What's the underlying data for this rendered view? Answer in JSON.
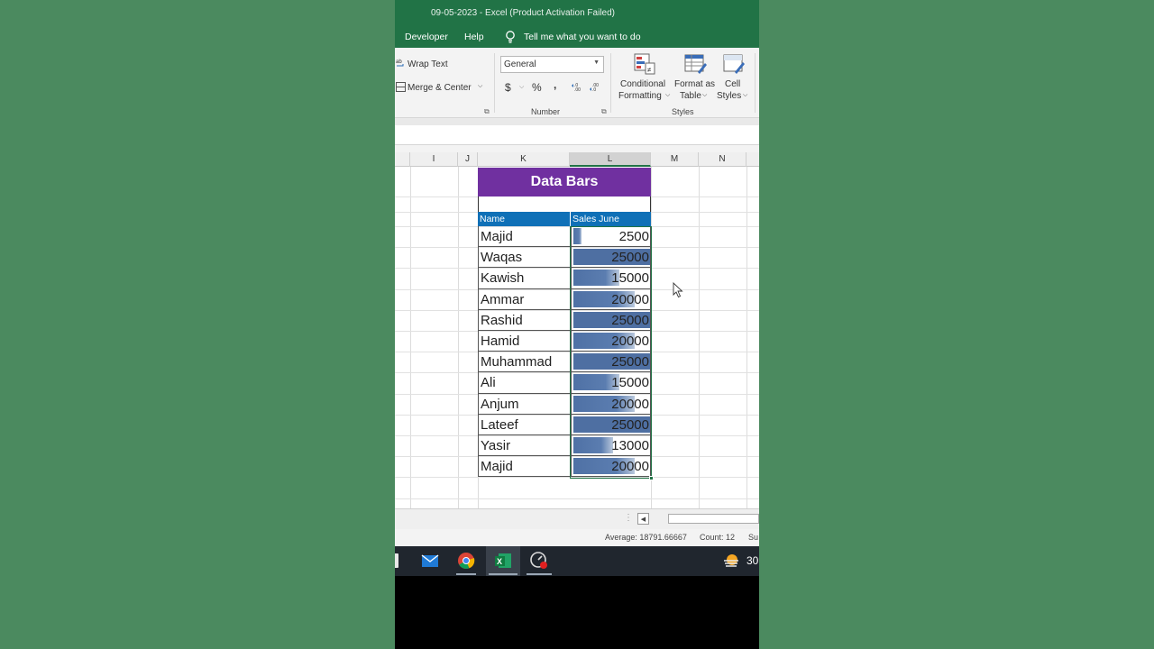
{
  "window": {
    "title": "09-05-2023  -  Excel (Product Activation Failed)"
  },
  "menu": {
    "developer": "Developer",
    "help": "Help",
    "tell_me": "Tell me what you want to do"
  },
  "ribbon": {
    "wrap_text": "Wrap Text",
    "merge_center": "Merge & Center",
    "number_format": "General",
    "currency": "$",
    "percent": "%",
    "comma": ",",
    "number_group": "Number",
    "conditional_formatting_1": "Conditional",
    "conditional_formatting_2": "Formatting",
    "format_table_1": "Format as",
    "format_table_2": "Table",
    "cell_styles_1": "Cell",
    "cell_styles_2": "Styles",
    "styles_group": "Styles"
  },
  "columns": [
    "I",
    "J",
    "K",
    "L",
    "M",
    "N"
  ],
  "sheet": {
    "banner": "Data Bars",
    "col_name": "Name",
    "col_sales": "Sales June",
    "max_value": 25000,
    "rows": [
      {
        "name": "Majid",
        "value": 2500
      },
      {
        "name": "Waqas",
        "value": 25000
      },
      {
        "name": "Kawish",
        "value": 15000
      },
      {
        "name": "Ammar",
        "value": 20000
      },
      {
        "name": "Rashid",
        "value": 25000
      },
      {
        "name": "Hamid",
        "value": 20000
      },
      {
        "name": "Muhammad",
        "value": 25000
      },
      {
        "name": "Ali",
        "value": 15000
      },
      {
        "name": "Anjum",
        "value": 20000
      },
      {
        "name": "Lateef",
        "value": 25000
      },
      {
        "name": "Yasir",
        "value": 13000
      },
      {
        "name": "Majid",
        "value": 20000
      }
    ]
  },
  "status": {
    "average": "Average: 18791.66667",
    "count": "Count: 12",
    "sum_partial": "Su"
  },
  "taskbar": {
    "weather_partial": "30"
  }
}
